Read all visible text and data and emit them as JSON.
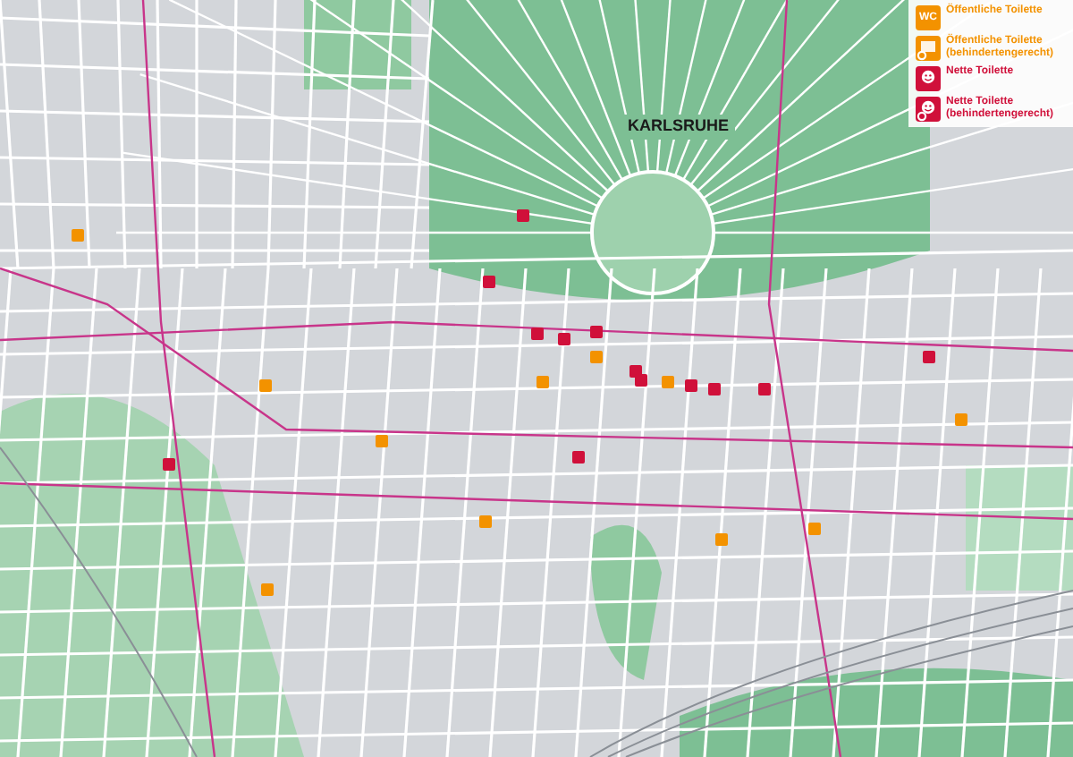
{
  "map": {
    "city_label": "KARLSRUHE"
  },
  "legend": {
    "items": [
      {
        "kind": "public",
        "icon_text": "WC",
        "color": "#f39200",
        "label": "Öffentliche Toilette"
      },
      {
        "kind": "public_accessible",
        "color": "#f39200",
        "label": "Öffentliche Toilette (behindertengerecht)"
      },
      {
        "kind": "nice",
        "color": "#d0103a",
        "label": "Nette Toilette"
      },
      {
        "kind": "nice_accessible",
        "color": "#d0103a",
        "label": "Nette Toilette (behindertengerecht)"
      }
    ]
  }
}
